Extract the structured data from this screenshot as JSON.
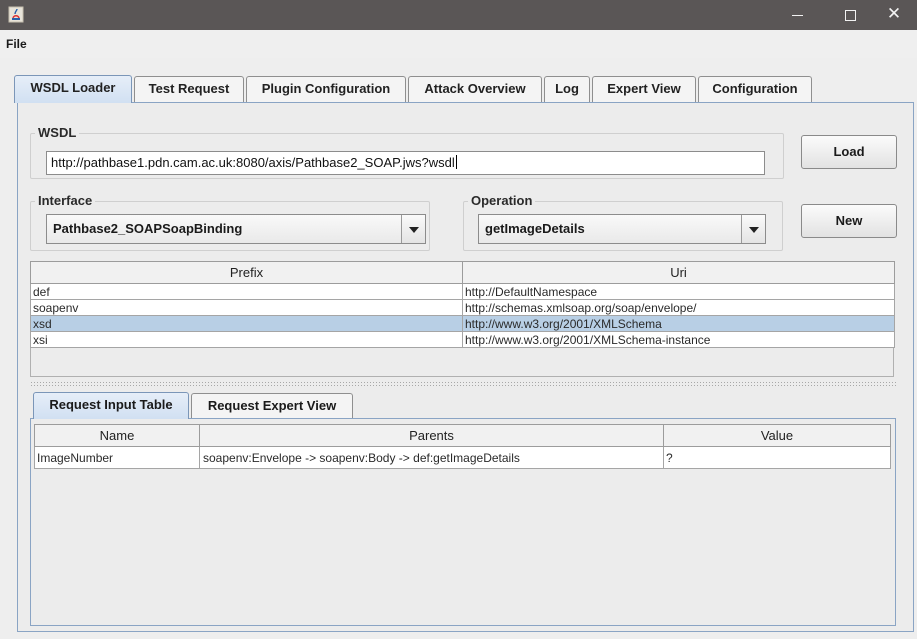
{
  "window": {
    "title": "",
    "controls": {
      "minimize": "minimize-icon",
      "maximize": "maximize-icon",
      "close": "close-icon"
    }
  },
  "menubar": {
    "file_label": "File"
  },
  "tabs": [
    {
      "label": "WSDL Loader",
      "active": true
    },
    {
      "label": "Test Request",
      "active": false
    },
    {
      "label": "Plugin Configuration",
      "active": false
    },
    {
      "label": "Attack Overview",
      "active": false
    },
    {
      "label": "Log",
      "active": false
    },
    {
      "label": "Expert View",
      "active": false
    },
    {
      "label": "Configuration",
      "active": false
    }
  ],
  "wsdl": {
    "group_label": "WSDL",
    "url_value": "http://pathbase1.pdn.cam.ac.uk:8080/axis/Pathbase2_SOAP.jws?wsdl",
    "load_label": "Load"
  },
  "interface": {
    "group_label": "Interface",
    "selected": "Pathbase2_SOAPSoapBinding"
  },
  "operation": {
    "group_label": "Operation",
    "selected": "getImageDetails"
  },
  "new_label": "New",
  "namespaces": {
    "columns": [
      "Prefix",
      "Uri"
    ],
    "rows": [
      {
        "prefix": "def",
        "uri": "http://DefaultNamespace"
      },
      {
        "prefix": "soapenv",
        "uri": "http://schemas.xmlsoap.org/soap/envelope/"
      },
      {
        "prefix": "xsd",
        "uri": "http://www.w3.org/2001/XMLSchema"
      },
      {
        "prefix": "xsi",
        "uri": "http://www.w3.org/2001/XMLSchema-instance"
      }
    ],
    "selected_row": 2
  },
  "subtabs": [
    {
      "label": "Request Input Table",
      "active": true
    },
    {
      "label": "Request Expert View",
      "active": false
    }
  ],
  "request_table": {
    "columns": [
      "Name",
      "Parents",
      "Value"
    ],
    "rows": [
      {
        "name": "ImageNumber",
        "parents": "soapenv:Envelope -> soapenv:Body -> def:getImageDetails",
        "value": "?"
      }
    ]
  },
  "colors": {
    "titlebar": "#5a5656",
    "selection": "#b8cfe5",
    "active_tab": "#d1e0f2"
  }
}
